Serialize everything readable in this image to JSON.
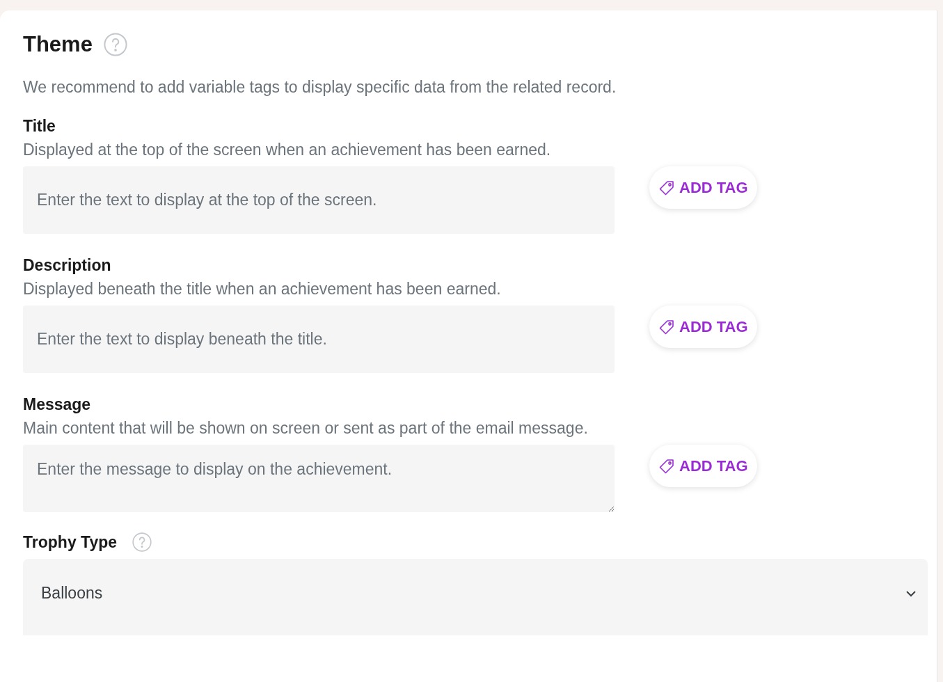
{
  "section": {
    "title": "Theme",
    "intro": "We recommend to add variable tags to display specific data from the related record."
  },
  "fields": [
    {
      "kind": "input",
      "label": "Title",
      "description": "Displayed at the top of the screen when an achievement has been earned.",
      "placeholder": "Enter the text to display at the top of the screen.",
      "button": "ADD TAG"
    },
    {
      "kind": "input",
      "label": "Description",
      "description": "Displayed beneath the title when an achievement has been earned.",
      "placeholder": "Enter the text to display beneath the title.",
      "button": "ADD TAG"
    },
    {
      "kind": "textarea",
      "label": "Message",
      "description": "Main content that will be shown on screen or sent as part of the email message.",
      "placeholder": "Enter the message to display on the achievement.",
      "button": "ADD TAG"
    }
  ],
  "trophy": {
    "label": "Trophy Type",
    "value": "Balloons"
  }
}
